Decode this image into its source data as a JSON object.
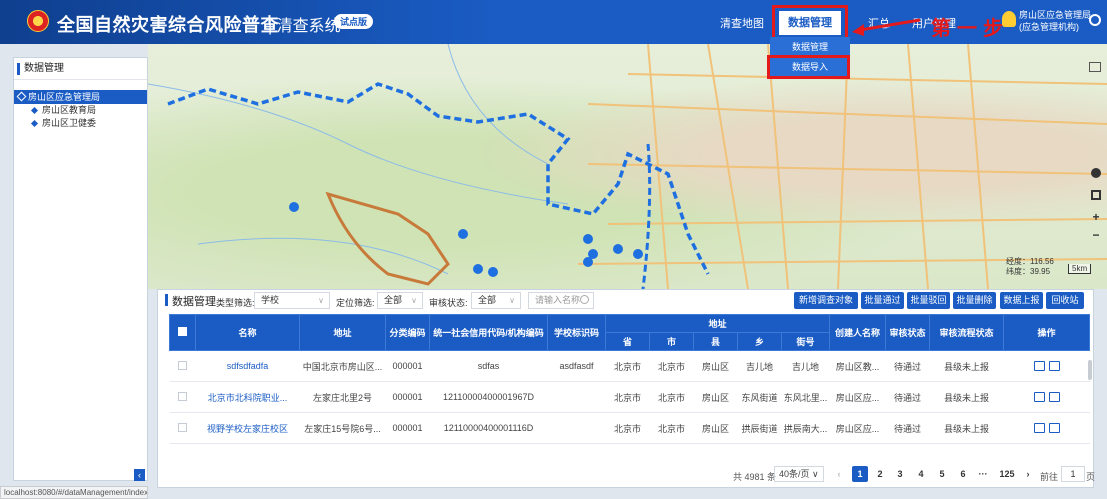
{
  "header": {
    "title": "全国自然灾害综合风险普查",
    "subtitle": "| 清查系统",
    "badge": "试点版",
    "nav": [
      "清查地图",
      "数据管理",
      "汇总",
      "用户管理"
    ],
    "annotation_step": "第一步",
    "user": {
      "line1": "房山区应急管理局",
      "line2": "(应急管理机构)"
    },
    "colors": {
      "primary": "#1a5cc4",
      "annotation": "#e3191b"
    }
  },
  "dropdown": {
    "items": [
      "数据管理",
      "数据导入"
    ]
  },
  "map": {
    "lng_label": "经度：116.56",
    "lat_label": "纬度：39.95",
    "scale": "5km"
  },
  "sidebar": {
    "title": "数据管理",
    "root": "房山区应急管理局",
    "children": [
      "房山区教育局",
      "房山区卫健委"
    ],
    "collapse_icon": "‹"
  },
  "panel": {
    "title": "数据管理",
    "filters": {
      "type_label": "类型筛选:",
      "type_value": "学校",
      "loc_label": "定位筛选:",
      "loc_value": "全部",
      "audit_label": "审核状态:",
      "audit_value": "全部",
      "search_placeholder": "请输入名称"
    },
    "actions": [
      "新增调查对象",
      "批量通过",
      "批量驳回",
      "批量删除",
      "数据上报",
      "回收站"
    ],
    "table": {
      "headers": {
        "name": "名称",
        "address": "地址",
        "category": "分类编码",
        "credit": "统一社会信用代码/机构编码",
        "school_id": "学校标识码",
        "addr_group": "地址",
        "province": "省",
        "city": "市",
        "county": "县",
        "town": "乡",
        "street": "街号",
        "creator": "创建人名称",
        "audit": "审核状态",
        "flow": "审核流程状态",
        "op": "操作"
      },
      "rows": [
        {
          "name": "sdfsdfadfa",
          "address": "中国北京市房山区...",
          "category": "000001",
          "credit": "sdfas",
          "school_id": "asdfasdf",
          "province": "北京市",
          "city": "北京市",
          "county": "房山区",
          "town": "吉儿地",
          "street": "吉儿地",
          "creator": "房山区教...",
          "audit": "待通过",
          "flow": "县级未上报"
        },
        {
          "name": "北京市北科院职业...",
          "address": "左家庄北里2号",
          "category": "000001",
          "credit": "12110000400001967D",
          "school_id": "",
          "province": "北京市",
          "city": "北京市",
          "county": "房山区",
          "town": "东风街道",
          "street": "东风北里...",
          "creator": "房山区应...",
          "audit": "待通过",
          "flow": "县级未上报"
        },
        {
          "name": "视野学校左家庄校区",
          "address": "左家庄15号院6号...",
          "category": "000001",
          "credit": "12110000400001116D",
          "school_id": "",
          "province": "北京市",
          "city": "北京市",
          "county": "房山区",
          "town": "拱辰街道",
          "street": "拱辰南大...",
          "creator": "房山区应...",
          "audit": "待通过",
          "flow": "县级未上报"
        }
      ]
    },
    "pagination": {
      "total": "共 4981 条",
      "page_size": "40条/页",
      "prev": "‹",
      "pages": [
        "1",
        "2",
        "3",
        "4",
        "5",
        "6",
        "···",
        "125"
      ],
      "next": "›",
      "goto_label": "前往",
      "goto_value": "1",
      "goto_unit": "页"
    }
  },
  "statusbar": {
    "url": "localhost:8080/#/dataManagement/index"
  }
}
